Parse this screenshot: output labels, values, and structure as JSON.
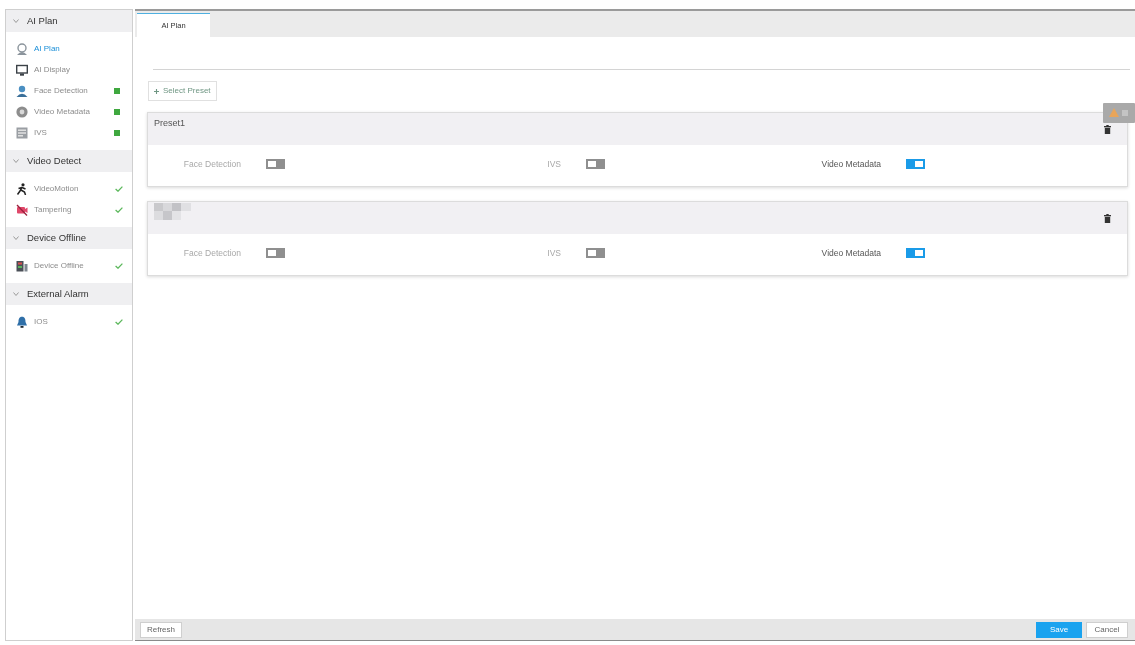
{
  "sidebar": {
    "sections": [
      {
        "title": "AI Plan",
        "expanded": true,
        "items": [
          {
            "label": "AI Plan",
            "selected": true,
            "kind": "plain"
          },
          {
            "label": "AI Display",
            "selected": false,
            "kind": "plain"
          },
          {
            "label": "Face Detection",
            "selected": false,
            "kind": "square"
          },
          {
            "label": "Video Metadata",
            "selected": false,
            "kind": "square"
          },
          {
            "label": "IVS",
            "selected": false,
            "kind": "square"
          }
        ]
      },
      {
        "title": "Video Detect",
        "expanded": true,
        "items": [
          {
            "label": "VideoMotion",
            "selected": false,
            "kind": "check"
          },
          {
            "label": "Tampering",
            "selected": false,
            "kind": "check"
          }
        ]
      },
      {
        "title": "Device Offline",
        "expanded": true,
        "items": [
          {
            "label": "Device Offline",
            "selected": false,
            "kind": "check"
          }
        ]
      },
      {
        "title": "External Alarm",
        "expanded": true,
        "items": [
          {
            "label": "IOS",
            "selected": false,
            "kind": "check"
          }
        ]
      }
    ]
  },
  "tabs": [
    {
      "label": "AI Plan",
      "selected": true
    }
  ],
  "select_preset_button": {
    "label": "Select Preset"
  },
  "presets": [
    {
      "name": "Preset1",
      "functions": [
        {
          "label": "Face Detection",
          "on": false
        },
        {
          "label": "IVS",
          "on": false
        },
        {
          "label": "Video Metadata",
          "on": true
        }
      ]
    },
    {
      "name_hidden": true,
      "functions": [
        {
          "label": "Face Detection",
          "on": false
        },
        {
          "label": "IVS",
          "on": false
        },
        {
          "label": "Video Metadata",
          "on": true
        }
      ]
    }
  ],
  "footer": {
    "left_buttons": [
      {
        "label": "Refresh",
        "kind": "default"
      }
    ],
    "right_buttons": [
      {
        "label": "Save",
        "kind": "primary"
      },
      {
        "label": "Cancel",
        "kind": "default"
      }
    ]
  }
}
